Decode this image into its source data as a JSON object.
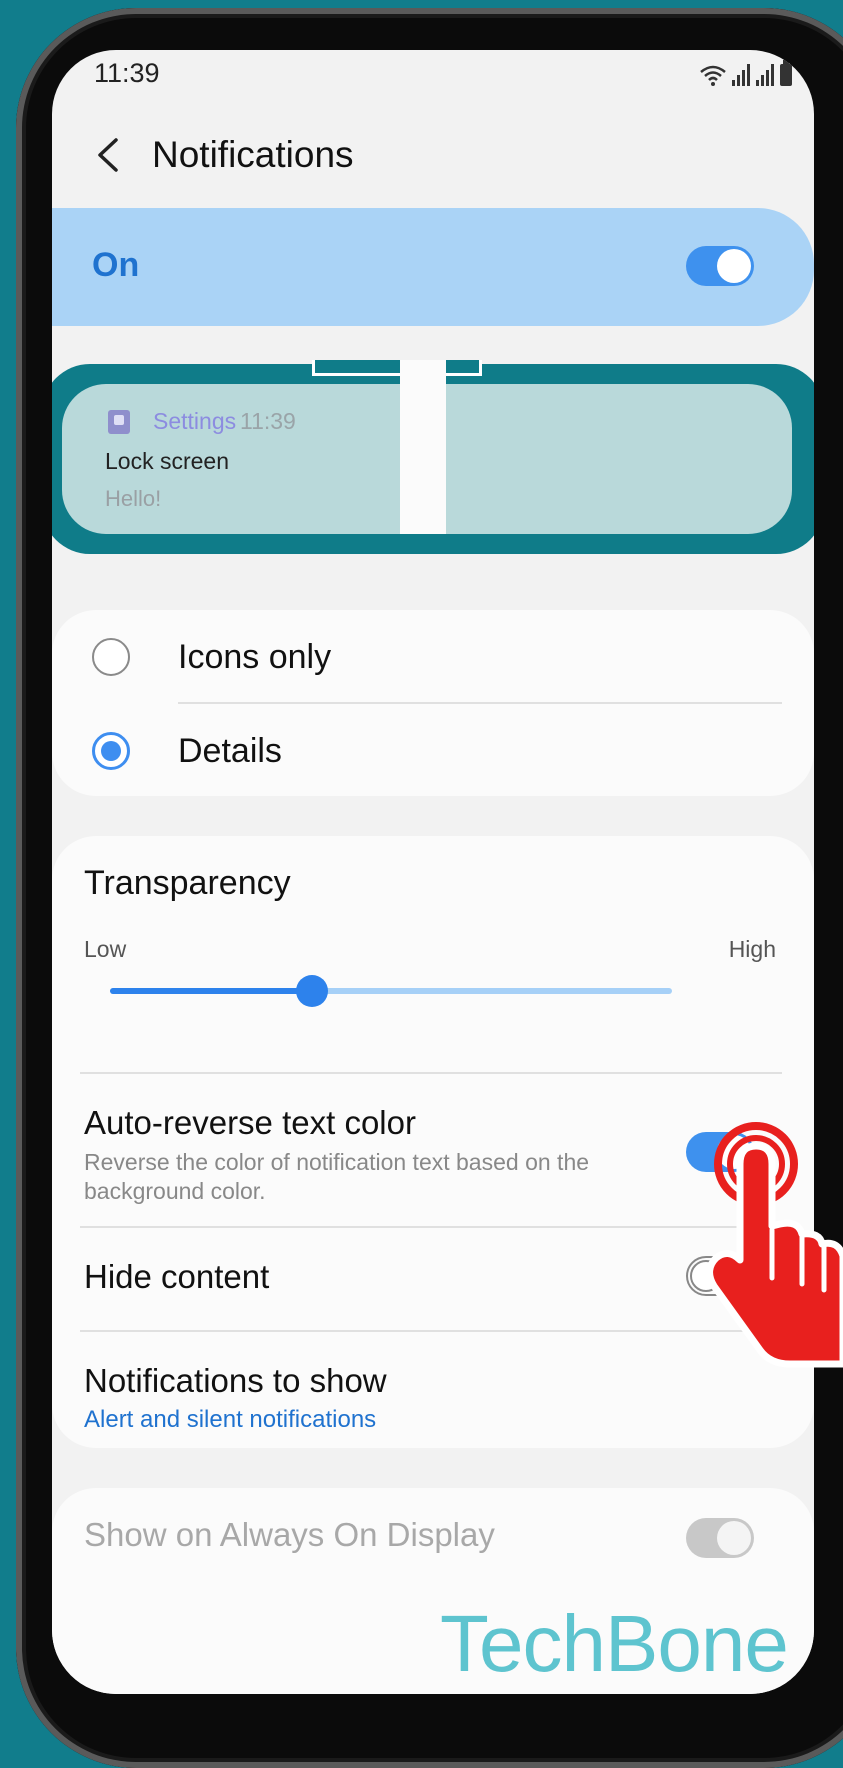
{
  "status_bar": {
    "time": "11:39"
  },
  "header": {
    "title": "Notifications"
  },
  "master_toggle": {
    "label": "On",
    "state": true
  },
  "preview": {
    "app_name": "Settings",
    "time": "11:39",
    "title": "Lock screen",
    "body": "Hello!"
  },
  "style_options": {
    "items": [
      {
        "label": "Icons only",
        "selected": false
      },
      {
        "label": "Details",
        "selected": true
      }
    ]
  },
  "transparency": {
    "title": "Transparency",
    "low_label": "Low",
    "high_label": "High",
    "level": 0.36
  },
  "auto_reverse": {
    "title": "Auto-reverse text color",
    "subtitle": "Reverse the color of notification text based on the background color.",
    "state": true
  },
  "hide_content": {
    "title": "Hide content",
    "state": false
  },
  "notifications_to_show": {
    "title": "Notifications to show",
    "value": "Alert and silent notifications"
  },
  "always_on_display": {
    "title": "Show on Always On Display",
    "state": true,
    "enabled": false
  },
  "watermark": "TechBone",
  "colors": {
    "accent": "#3e91ee",
    "background": "#117d8c",
    "on_card": "#aad3f6",
    "tap_indicator": "#e8201e"
  }
}
